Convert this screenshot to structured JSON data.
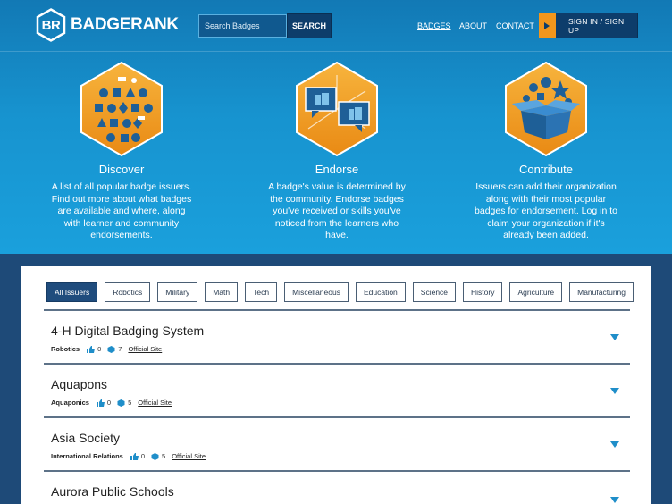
{
  "brand": {
    "initials": "BR",
    "name": "BADGERANK"
  },
  "search": {
    "placeholder": "Search Badges",
    "button": "SEARCH"
  },
  "nav": {
    "badges": "BADGES",
    "about": "ABOUT",
    "contact": "CONTACT",
    "signin": "SIGN IN / SIGN UP"
  },
  "features": [
    {
      "title": "Discover",
      "text": "A list of all popular badge issuers. Find out more about what badges are available and where, along with learner and community endorsements."
    },
    {
      "title": "Endorse",
      "text": "A badge's value is determined by the community. Endorse badges you've received or skills you've noticed from the learners who have."
    },
    {
      "title": "Contribute",
      "text": "Issuers can add their organization along with their most popular badges for endorsement. Log in to claim your organization if it's already been added."
    }
  ],
  "filters": [
    "All Issuers",
    "Robotics",
    "Military",
    "Math",
    "Tech",
    "Miscellaneous",
    "Education",
    "Science",
    "History",
    "Agriculture",
    "Manufacturing"
  ],
  "issuers": [
    {
      "name": "4-H Digital Badging System",
      "category": "Robotics",
      "endorsements": "0",
      "badges": "7",
      "link": "Official Site"
    },
    {
      "name": "Aquapons",
      "category": "Aquaponics",
      "endorsements": "0",
      "badges": "5",
      "link": "Official Site"
    },
    {
      "name": "Asia Society",
      "category": "International Relations",
      "endorsements": "0",
      "badges": "5",
      "link": "Official Site"
    },
    {
      "name": "Aurora Public Schools",
      "category": "",
      "endorsements": "",
      "badges": "",
      "link": ""
    }
  ],
  "colors": {
    "hero": "#1793cf",
    "navy": "#0d3d6b",
    "accent": "#f2961c",
    "caret": "#1f8ec9"
  }
}
